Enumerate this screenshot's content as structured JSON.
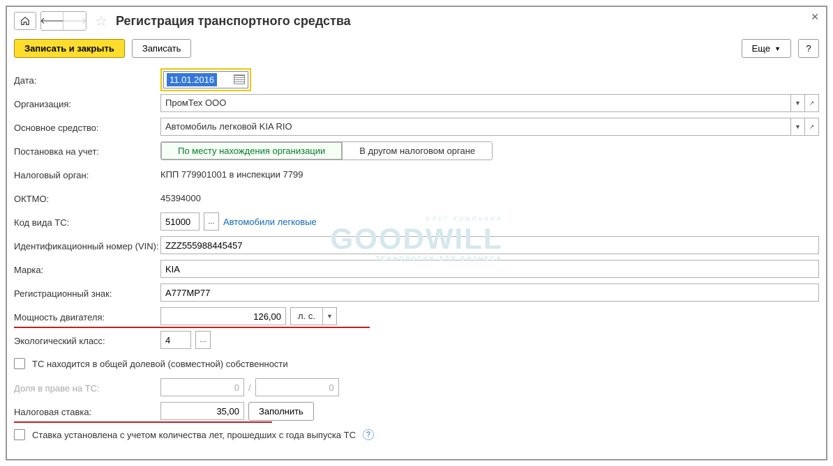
{
  "title": "Регистрация транспортного средства",
  "toolbar": {
    "save_close": "Записать и закрыть",
    "save": "Записать",
    "more": "Еще",
    "help": "?"
  },
  "labels": {
    "date": "Дата:",
    "org": "Организация:",
    "asset": "Основное средство:",
    "registration": "Постановка на учет:",
    "tax_authority": "Налоговый орган:",
    "oktmo": "ОКТМО:",
    "vehicle_code": "Код вида ТС:",
    "vin": "Идентификационный номер (VIN):",
    "brand": "Марка:",
    "reg_plate": "Регистрационный знак:",
    "engine_power": "Мощность двигателя:",
    "eco_class": "Экологический класс:",
    "shared_ownership": "ТС находится в общей долевой (совместной) собственности",
    "share": "Доля в праве на ТС:",
    "tax_rate": "Налоговая ставка:",
    "rate_years": "Ставка установлена с учетом количества лет, прошедших с года выпуска ТС"
  },
  "values": {
    "date": "11.01.2016",
    "org": "ПромТех ООО",
    "asset": "Автомобиль легковой KIA RIO",
    "reg_option_a": "По месту нахождения организации",
    "reg_option_b": "В другом налоговом органе",
    "tax_authority": "КПП 779901001 в инспекции 7799",
    "oktmo": "45394000",
    "vehicle_code": "51000",
    "vehicle_code_desc": "Автомобили легковые",
    "vin": "ZZZ555988445457",
    "brand": "KIA",
    "reg_plate": "А777МР77",
    "engine_power": "126,00",
    "power_unit": "л. с.",
    "eco_class": "4",
    "share_a": "0",
    "share_b": "0",
    "share_sep": "/",
    "tax_rate": "35,00",
    "fill_btn": "Заполнить"
  },
  "watermark": {
    "top": "БЛОГ КОМПАНИИ",
    "main": "GOODWILL",
    "sub": "ТЕХНОЛОГИИ ДЛЯ БИЗНЕСА"
  }
}
